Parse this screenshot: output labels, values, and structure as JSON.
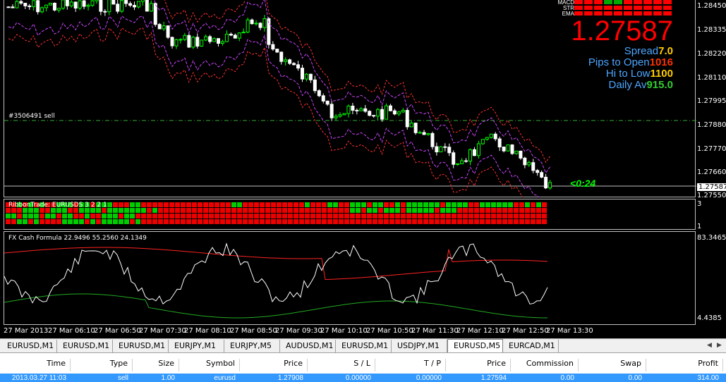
{
  "chart": {
    "symbol_timeframe": "EURUSD,M5",
    "price_axis": [
      "1.28450",
      "1.28335",
      "1.28220",
      "1.28110",
      "1.27995",
      "1.27880",
      "1.27770",
      "1.27660",
      "1.27587",
      "1.27550"
    ],
    "current_price": "1.27587",
    "order_line_label": "#3506491 sell",
    "countdown": "<0:24",
    "ribbon_title": "RibbonTrade: EURUSDS 3 2 2 1",
    "ribbon_axis": [
      "3",
      "1"
    ],
    "osc_title": "FX Cash Formula 22.9496 55.2560 24.1349",
    "osc_axis": [
      "83.3465",
      "4.4385"
    ],
    "time_axis": [
      "27 Mar 2013",
      "27 Mar 06:10",
      "27 Mar 06:50",
      "27 Mar 07:30",
      "27 Mar 08:10",
      "27 Mar 08:50",
      "27 Mar 09:30",
      "27 Mar 10:10",
      "27 Mar 10:50",
      "27 Mar 11:30",
      "27 Mar 12:10",
      "27 Mar 12:50",
      "27 Mar 13:30"
    ]
  },
  "hud": {
    "legend": [
      "MACD",
      "STR",
      "EMA"
    ],
    "big_price": "1.27587",
    "rows": [
      {
        "label": "Spread",
        "value": "7.0",
        "color": "#ffcc00"
      },
      {
        "label": "Pips to Open",
        "value": "1016",
        "color": "#ff3300"
      },
      {
        "label": "Hi to Low",
        "value": "1100",
        "color": "#ffcc00"
      },
      {
        "label": "Daily Av",
        "value": "915.0",
        "color": "#33cc33"
      }
    ]
  },
  "tabs": [
    "EURUSD,M1",
    "EURUSD,M1",
    "EURUSD,M1",
    "EURJPY,M1",
    "EURJPY,M5",
    "AUDUSD,M1",
    "EURUSD,M1",
    "USDJPY,M1",
    "EURUSD,M5",
    "EURCAD,M1"
  ],
  "active_tab": 8,
  "terminal": {
    "headers": [
      "Time",
      "Type",
      "Size",
      "Symbol",
      "Price",
      "S / L",
      "T / P",
      "Price",
      "Commission",
      "Swap",
      "Profit"
    ],
    "row": [
      "2013.03.27 11:03",
      "sell",
      "1.00",
      "eurusd",
      "1.27908",
      "0.00000",
      "0.00000",
      "1.27594",
      "0.00",
      "0.00",
      "314.00"
    ]
  },
  "colors": {
    "bull": "#00ff00",
    "bear": "#ff0000",
    "band": "#ff3333",
    "band2": "#cc44ff",
    "accent": "#3399ff"
  }
}
